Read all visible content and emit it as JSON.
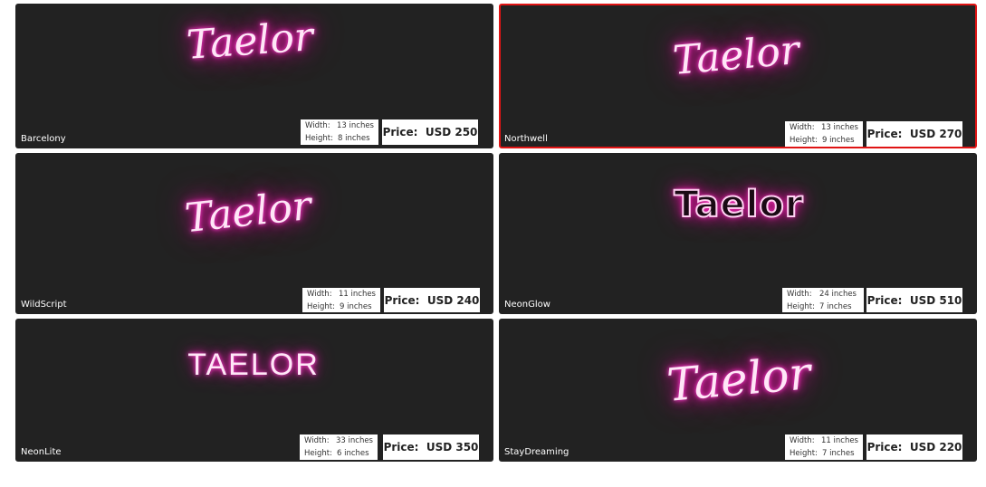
{
  "labels": {
    "width": "Width:",
    "height": "Height:",
    "price": "Price:"
  },
  "colors": {
    "card_background": "#222222",
    "selected_border": "#e01414",
    "neon_pink": "#ff1fb9"
  },
  "cards": [
    {
      "font_name": "Barcelony",
      "preview_text": "Taelor",
      "width": "13 inches",
      "height": "8 inches",
      "price": "USD 250",
      "selected": false
    },
    {
      "font_name": "Northwell",
      "preview_text": "Taelor",
      "width": "13 inches",
      "height": "9 inches",
      "price": "USD 270",
      "selected": true
    },
    {
      "font_name": "WildScript",
      "preview_text": "Taelor",
      "width": "11 inches",
      "height": "9 inches",
      "price": "USD 240",
      "selected": false
    },
    {
      "font_name": "NeonGlow",
      "preview_text": "Taelor",
      "width": "24 inches",
      "height": "7 inches",
      "price": "USD 510",
      "selected": false
    },
    {
      "font_name": "NeonLite",
      "preview_text": "TAELOR",
      "width": "33 inches",
      "height": "6 inches",
      "price": "USD 350",
      "selected": false
    },
    {
      "font_name": "StayDreaming",
      "preview_text": "Taelor",
      "width": "11 inches",
      "height": "7 inches",
      "price": "USD 220",
      "selected": false
    }
  ]
}
